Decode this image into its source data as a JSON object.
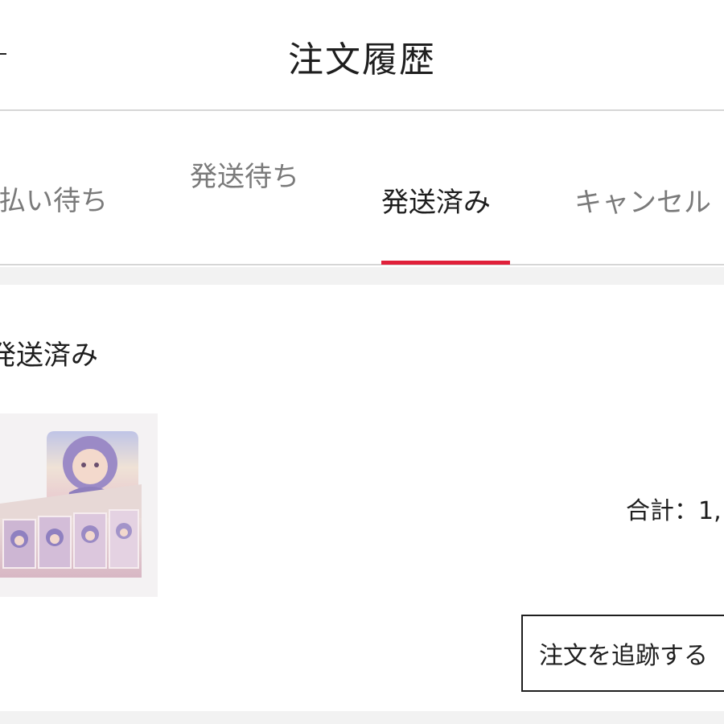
{
  "header": {
    "title": "注文履歴"
  },
  "tabs": [
    {
      "label": "払い待ち"
    },
    {
      "label": "発送待ち"
    },
    {
      "label": "発送済み",
      "active": true
    },
    {
      "label": "キャンセル"
    }
  ],
  "order": {
    "status": "発送済み",
    "total_text": "合計：1,",
    "track_button_label": "注文を追跡する"
  },
  "colors": {
    "accent": "#e0203a",
    "active_tab_text": "#1e1e1e",
    "inactive_tab_text": "#7a7a7a",
    "divider": "#d6d6d6",
    "band": "#f2f2f2"
  },
  "icons": {
    "back": "back-arrow-icon"
  }
}
